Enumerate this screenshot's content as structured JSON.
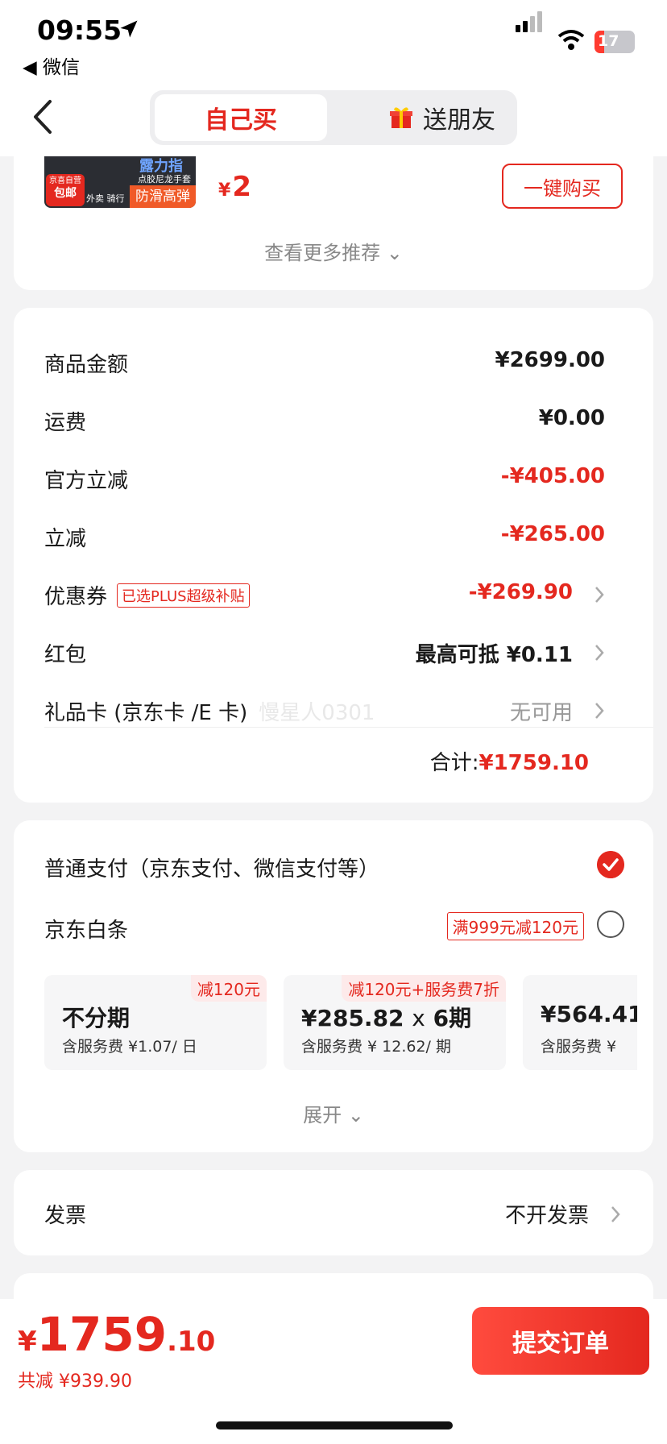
{
  "status_bar": {
    "time": "09:55",
    "back_app": "◀ 微信",
    "battery": "17"
  },
  "nav": {
    "tab_self": "自己买",
    "tab_gift": "送朋友"
  },
  "recommend": {
    "thumb_title": "露力指",
    "thumb_sub": "点胶尼龙手套",
    "badge_top": "京喜自营",
    "badge_main": "包邮",
    "tag_small": "外卖 骑行",
    "tag_main": "防滑高弹",
    "currency": "¥",
    "price": "2",
    "buy_button": "一键购买",
    "more_label": "查看更多推荐 ⌄"
  },
  "price_details": {
    "rows": [
      {
        "label": "商品金额",
        "value": "¥2699.00"
      },
      {
        "label": "运费",
        "value": "¥0.00"
      },
      {
        "label": "官方立减",
        "value": "-¥405.00"
      },
      {
        "label": "立减",
        "value": "-¥265.00"
      },
      {
        "label": "优惠券",
        "tag": "已选PLUS超级补贴",
        "value": "-¥269.90"
      },
      {
        "label": "红包",
        "value": "最高可抵 ¥0.11"
      },
      {
        "label": "礼品卡 (京东卡 /E 卡)",
        "watermark": "慢星人0301",
        "value": "无可用"
      }
    ],
    "total_label": "合计:",
    "total_value": "¥1759.10"
  },
  "payment": {
    "normal_label": "普通支付（京东支付、微信支付等）",
    "baitiao_label": "京东白条",
    "baitiao_promo": "满999元减120元",
    "options": [
      {
        "tag": "减120元",
        "main": "不分期",
        "fee": "含服务费 ¥1.07/ 日"
      },
      {
        "tag": "减120元+服务费7折",
        "main": "¥285.82",
        "times": "x",
        "period": "6期",
        "fee": "含服务费 ¥ 12.62/ 期"
      },
      {
        "main": "¥564.41",
        "fee": "含服务费 ¥"
      }
    ],
    "expand_label": "展开 ⌄"
  },
  "invoice": {
    "label": "发票",
    "value": "不开发票"
  },
  "bottom": {
    "currency": "¥",
    "price_int": "1759",
    "price_dec": ".10",
    "saved": "共减 ¥939.90",
    "submit": "提交订单"
  },
  "colors": {
    "accent": "#e4281f",
    "background": "#f3f3f4"
  }
}
